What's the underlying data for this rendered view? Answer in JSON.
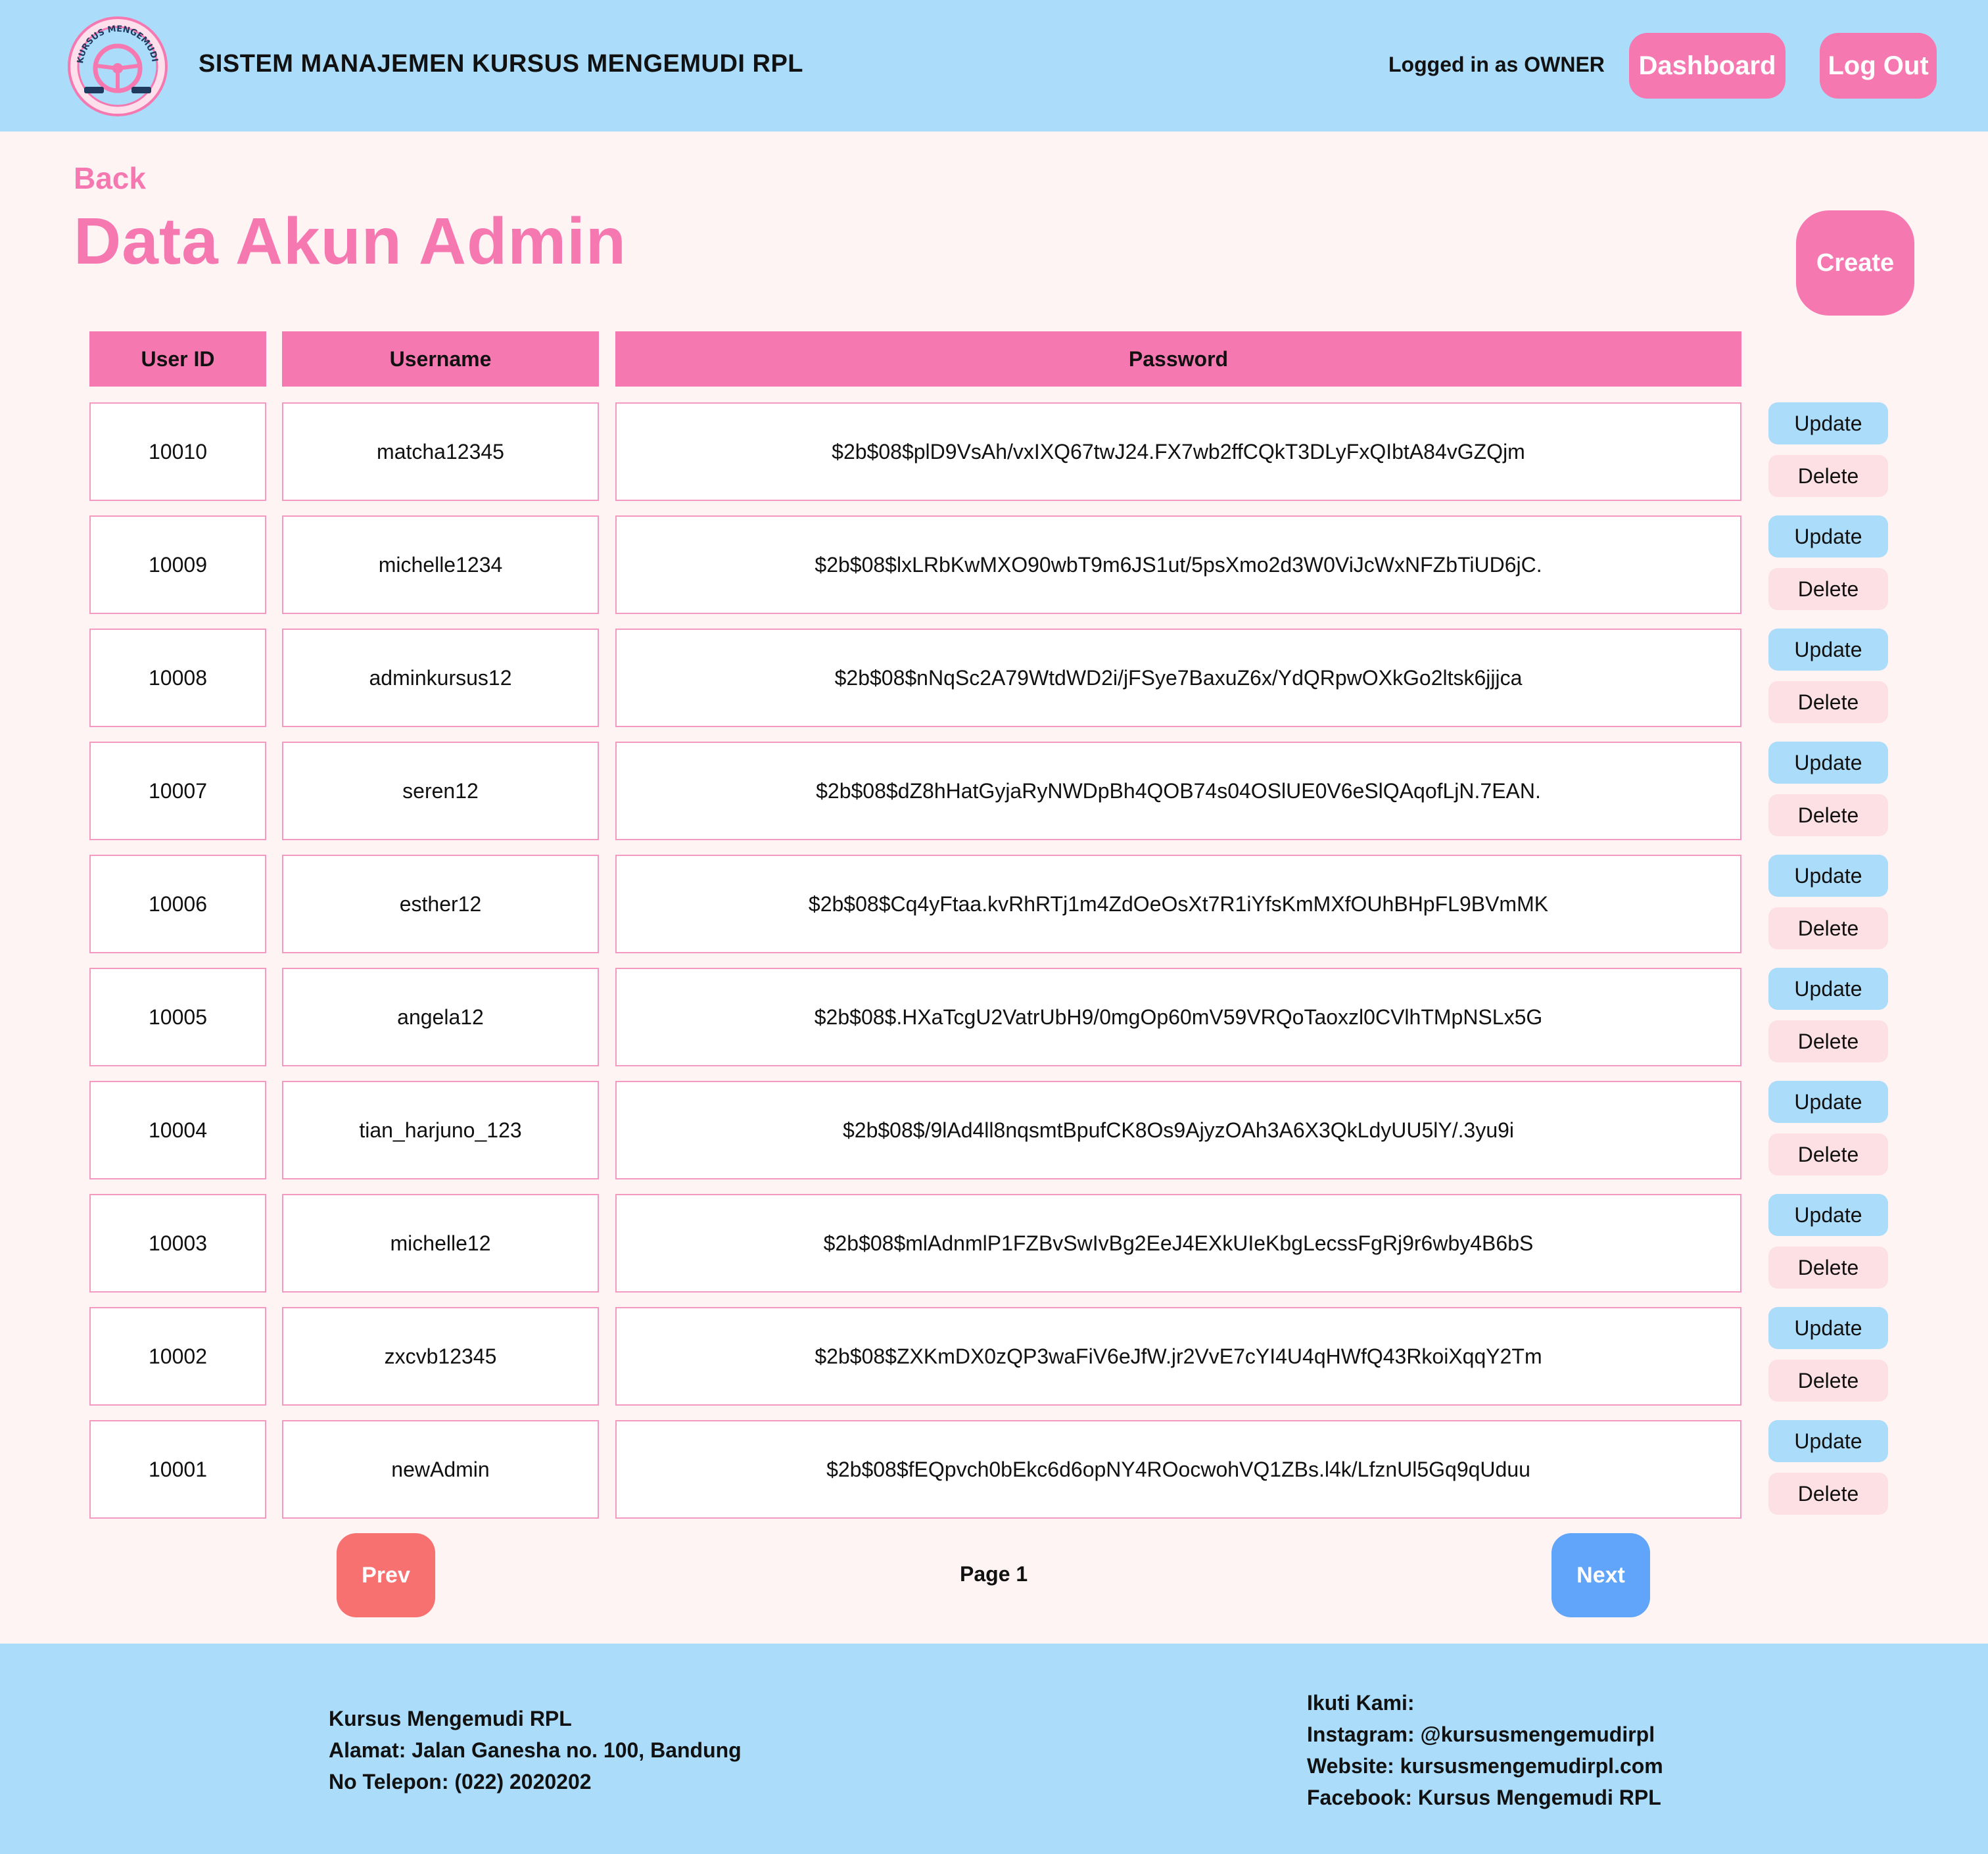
{
  "header": {
    "title": "SISTEM MANAJEMEN KURSUS MENGEMUDI RPL",
    "logged_in": "Logged in as OWNER",
    "dashboard_label": "Dashboard",
    "logout_label": "Log Out",
    "logo_icon": "steering-wheel-logo",
    "logo_text": "KURSUS MENGEMUDI RPL"
  },
  "page": {
    "back_label": "Back",
    "title": "Data Akun Admin",
    "create_label": "Create"
  },
  "table": {
    "headers": [
      "User ID",
      "Username",
      "Password"
    ],
    "update_label": "Update",
    "delete_label": "Delete",
    "rows": [
      {
        "id": "10010",
        "username": "matcha12345",
        "password": "$2b$08$plD9VsAh/vxIXQ67twJ24.FX7wb2ffCQkT3DLyFxQIbtA84vGZQjm"
      },
      {
        "id": "10009",
        "username": "michelle1234",
        "password": "$2b$08$lxLRbKwMXO90wbT9m6JS1ut/5psXmo2d3W0ViJcWxNFZbTiUD6jC."
      },
      {
        "id": "10008",
        "username": "adminkursus12",
        "password": "$2b$08$nNqSc2A79WtdWD2i/jFSye7BaxuZ6x/YdQRpwOXkGo2ltsk6jjjca"
      },
      {
        "id": "10007",
        "username": "seren12",
        "password": "$2b$08$dZ8hHatGyjaRyNWDpBh4QOB74s04OSlUE0V6eSlQAqofLjN.7EAN."
      },
      {
        "id": "10006",
        "username": "esther12",
        "password": "$2b$08$Cq4yFtaa.kvRhRTj1m4ZdOeOsXt7R1iYfsKmMXfOUhBHpFL9BVmMK"
      },
      {
        "id": "10005",
        "username": "angela12",
        "password": "$2b$08$.HXaTcgU2VatrUbH9/0mgOp60mV59VRQoTaoxzl0CVlhTMpNSLx5G"
      },
      {
        "id": "10004",
        "username": "tian_harjuno_123",
        "password": "$2b$08$/9lAd4ll8nqsmtBpufCK8Os9AjyzOAh3A6X3QkLdyUU5lY/.3yu9i"
      },
      {
        "id": "10003",
        "username": "michelle12",
        "password": "$2b$08$mlAdnmlP1FZBvSwIvBg2EeJ4EXkUIeKbgLecssFgRj9r6wby4B6bS"
      },
      {
        "id": "10002",
        "username": "zxcvb12345",
        "password": "$2b$08$ZXKmDX0zQP3waFiV6eJfW.jr2VvE7cYI4U4qHWfQ43RkoiXqqY2Tm"
      },
      {
        "id": "10001",
        "username": "newAdmin",
        "password": "$2b$08$fEQpvch0bEkc6d6opNY4ROocwohVQ1ZBs.l4k/LfznUl5Gq9qUduu"
      }
    ]
  },
  "pagination": {
    "prev_label": "Prev",
    "page_label": "Page 1",
    "next_label": "Next"
  },
  "footer": {
    "left": [
      "Kursus Mengemudi RPL",
      "Alamat: Jalan Ganesha no. 100, Bandung",
      "No Telepon: (022) 2020202"
    ],
    "right": [
      "Ikuti Kami:",
      "Instagram: @kursusmengemudirpl",
      "Website: kursusmengemudirpl.com",
      "Facebook: Kursus Mengemudi RPL"
    ]
  },
  "colors": {
    "header_bg": "#abdcfa",
    "accent_pink": "#f678b0",
    "page_bg": "#fff4f4",
    "update_bg": "#abdcfa",
    "delete_bg": "#fde0e4",
    "prev_bg": "#f87171",
    "next_bg": "#60a5fa"
  }
}
